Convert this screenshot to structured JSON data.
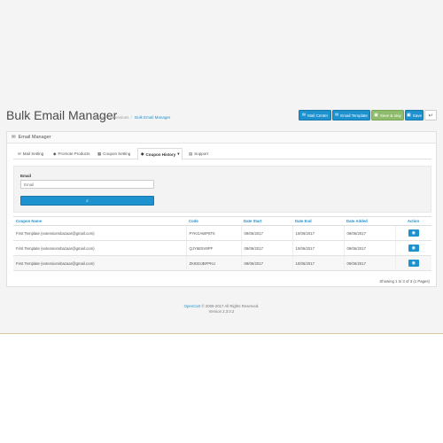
{
  "page": {
    "title": "Bulk Email Manager",
    "breadcrumb": [
      "Home",
      "Extensions",
      "Bulk Email Manager"
    ]
  },
  "toolbar": {
    "mail_center": "Mail Center",
    "email_template": "Email Template",
    "save_stay": "Save & stay",
    "save": "Save"
  },
  "panel": {
    "title": "Email Manager",
    "tabs": [
      {
        "label": "Mail Setting",
        "icon": "envelope-icon"
      },
      {
        "label": "Promote Products",
        "icon": "tag-icon"
      },
      {
        "label": "Coupon Setting",
        "icon": "ticket-icon"
      },
      {
        "label": "Coupon History",
        "icon": "tags-icon",
        "active": true
      },
      {
        "label": "Support",
        "icon": "file-icon"
      }
    ]
  },
  "filter": {
    "label": "Email",
    "placeholder": "Email"
  },
  "table": {
    "headers": [
      "Coupon Name",
      "Code",
      "Date Start",
      "Date End",
      "Date Added",
      "Action"
    ],
    "rows": [
      [
        "First Template (extensionsbazaar@gmail.com)",
        "PYKGAWP5T6",
        "09/06/2017",
        "10/06/2017",
        "09/06/2017"
      ],
      [
        "First Template (extensionsbazaar@gmail.com)",
        "QJY6E5V8PF",
        "09/06/2017",
        "10/06/2017",
        "09/06/2017"
      ],
      [
        "First Template (extensionsbazaar@gmail.com)",
        "ZK8S0JBFPKU",
        "09/06/2017",
        "10/06/2017",
        "09/06/2017"
      ]
    ],
    "pager": "Showing 1 to 3 of 3 (1 Pages)"
  },
  "footer": {
    "brand": "OpenCart",
    "copy": " © 2009-2017 All Rights Reserved.",
    "version": "Version 2.3.0.2"
  },
  "colors": {
    "accent": "#1e91cf",
    "success": "#8fbb6c"
  }
}
